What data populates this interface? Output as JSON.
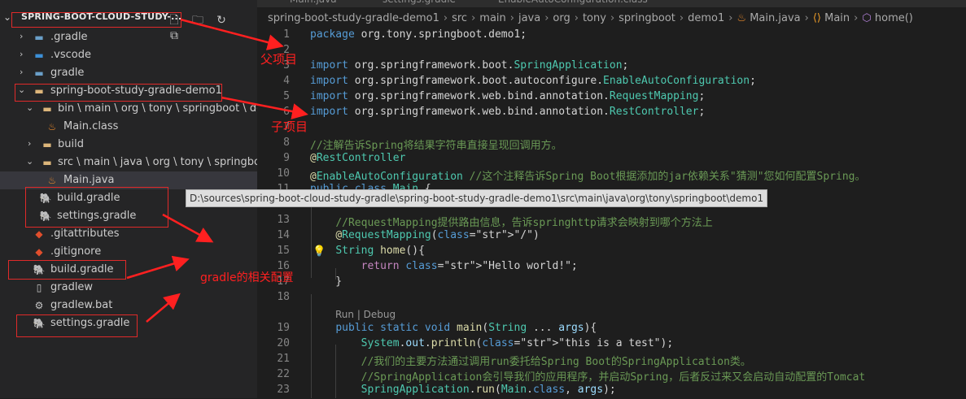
{
  "explorer": {
    "root_label": "SPRING-BOOT-CLOUD-STUDY-...",
    "actions": [
      "new-file-icon",
      "new-folder-icon",
      "refresh-icon",
      "collapse-all-icon"
    ],
    "items": [
      {
        "label": ".gradle",
        "icon": "folder-icon"
      },
      {
        "label": ".vscode",
        "icon": "vscode-folder-icon"
      },
      {
        "label": "gradle",
        "icon": "folder-icon"
      },
      {
        "label": "spring-boot-study-gradle-demo1",
        "icon": "folder-icon"
      },
      {
        "label": "bin \\ main \\ org \\ tony \\ springboot \\ de...",
        "icon": "folder-icon"
      },
      {
        "label": "Main.class",
        "icon": "java-icon"
      },
      {
        "label": "build",
        "icon": "folder-icon"
      },
      {
        "label": "src \\ main \\ java \\ org \\ tony \\ springboot ...",
        "icon": "folder-icon"
      },
      {
        "label": "Main.java",
        "icon": "java-icon"
      },
      {
        "label": "build.gradle",
        "icon": "gradle-icon"
      },
      {
        "label": "settings.gradle",
        "icon": "gradle-icon"
      },
      {
        "label": ".gitattributes",
        "icon": "git-icon"
      },
      {
        "label": ".gitignore",
        "icon": "git-icon"
      },
      {
        "label": "build.gradle",
        "icon": "gradle-icon"
      },
      {
        "label": "gradlew",
        "icon": "file-icon"
      },
      {
        "label": "gradlew.bat",
        "icon": "gear-icon"
      },
      {
        "label": "settings.gradle",
        "icon": "gradle-icon"
      }
    ]
  },
  "tabs": [
    "Main.java",
    "settings.gradle",
    "EnableAutoConfiguration.class"
  ],
  "breadcrumb": [
    "spring-boot-study-gradle-demo1",
    "src",
    "main",
    "java",
    "org",
    "tony",
    "springboot",
    "demo1",
    "Main.java",
    "Main",
    "home()"
  ],
  "editor": {
    "lines": [
      {
        "n": "1",
        "t": "package org.tony.springboot.demo1;"
      },
      {
        "n": "2",
        "t": ""
      },
      {
        "n": "3",
        "t": "import org.springframework.boot.SpringApplication;"
      },
      {
        "n": "4",
        "t": "import org.springframework.boot.autoconfigure.EnableAutoConfiguration;"
      },
      {
        "n": "5",
        "t": "import org.springframework.web.bind.annotation.RequestMapping;"
      },
      {
        "n": "6",
        "t": "import org.springframework.web.bind.annotation.RestController;"
      },
      {
        "n": "7",
        "t": ""
      },
      {
        "n": "8",
        "t": "//注解告诉Spring将结果字符串直接呈现回调用方。"
      },
      {
        "n": "9",
        "t": "@RestController"
      },
      {
        "n": "10",
        "t": "@EnableAutoConfiguration //这个注释告诉Spring Boot根据添加的jar依赖关系\"猜测\"您如何配置Spring。"
      },
      {
        "n": "11",
        "t": "public class Main {"
      },
      {
        "n": "12",
        "t": ""
      },
      {
        "n": "13",
        "t": "    //RequestMapping提供路由信息，告诉springhttp请求会映射到哪个方法上"
      },
      {
        "n": "14",
        "t": "    @RequestMapping(\"/\")"
      },
      {
        "n": "15",
        "t": "    String home(){"
      },
      {
        "n": "16",
        "t": "        return \"Hello world!\";"
      },
      {
        "n": "17",
        "t": "    }"
      },
      {
        "n": "18",
        "t": ""
      },
      {
        "n": "19",
        "t": "    public static void main(String ... args){"
      },
      {
        "n": "20",
        "t": "        System.out.println(\"this is a test\");"
      },
      {
        "n": "21",
        "t": "        //我们的主要方法通过调用run委托给Spring Boot的SpringApplication类。"
      },
      {
        "n": "22",
        "t": "        //SpringApplication会引导我们的应用程序，并启动Spring，后者反过来又会启动自动配置的Tomcat"
      },
      {
        "n": "23",
        "t": "        SpringApplication.run(Main.class, args);"
      }
    ],
    "codelens": "Run | Debug",
    "tooltip": "D:\\sources\\spring-boot-cloud-study-gradle\\spring-boot-study-gradle-demo1\\src\\main\\java\\org\\tony\\springboot\\demo1"
  },
  "annotations": {
    "parent": "父项目",
    "child": "子项目",
    "gradle_config": "gradle的相关配置"
  },
  "colors": {
    "annotation_red": "#ff2020",
    "sidebar_bg": "#252526",
    "editor_bg": "#1e1e1e"
  }
}
